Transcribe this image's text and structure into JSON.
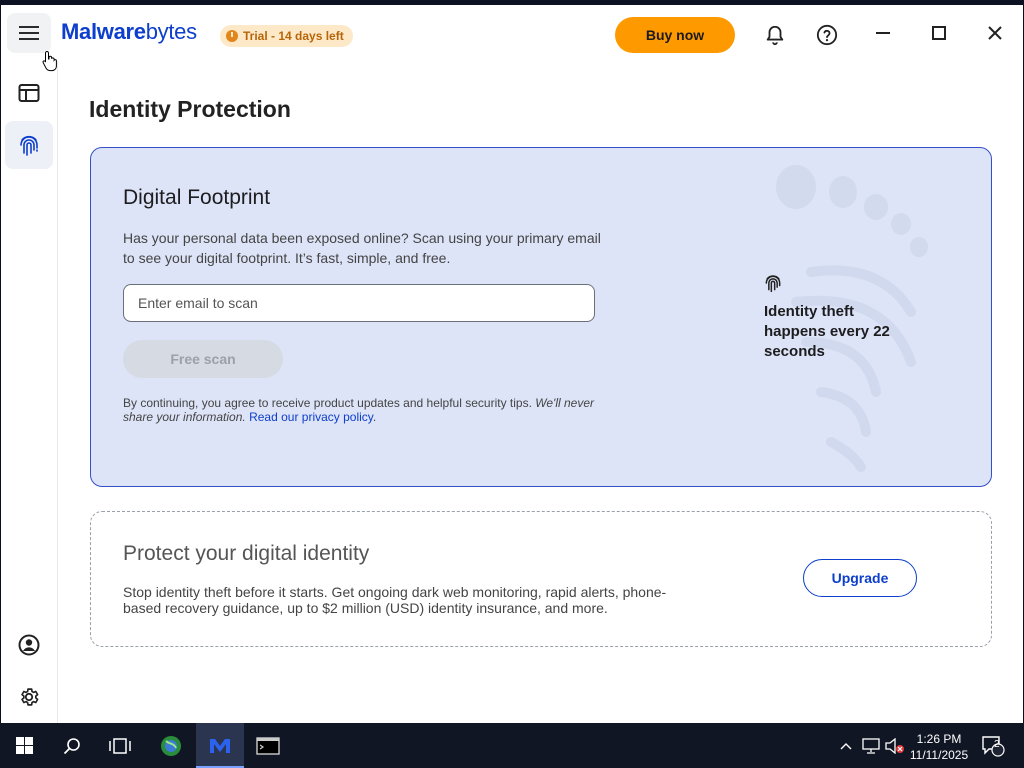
{
  "titlebar": {
    "logo_bold": "Malware",
    "logo_regular": "bytes",
    "trial_badge": "Trial - 14 days left",
    "buy_label": "Buy now"
  },
  "page": {
    "title": "Identity Protection"
  },
  "digital_footprint": {
    "heading": "Digital Footprint",
    "description": "Has your personal data been exposed online? Scan using your primary email to see your digital footprint. It’s fast, simple, and free.",
    "email_placeholder": "Enter email to scan",
    "scan_label": "Free scan",
    "consent_text": "By continuing, you agree to receive product updates and helpful security tips. ",
    "consent_italic": "We'll never share your information.",
    "privacy_link": "Read our privacy policy",
    "privacy_suffix": ".",
    "stat_text": "Identity theft happens every 22 seconds"
  },
  "protect": {
    "heading": "Protect your digital identity",
    "description": "Stop identity theft before it starts. Get ongoing dark web monitoring, rapid alerts, phone-based recovery guidance, up to $2 million (USD) identity insurance, and more.",
    "upgrade_label": "Upgrade"
  },
  "taskbar": {
    "time": "1:26 PM",
    "date": "11/11/2025",
    "notification_count": "2"
  },
  "colors": {
    "brand_blue": "#0d3ecc",
    "buy_orange": "#ff9900",
    "card_bg": "#dde4f7"
  },
  "icons": [
    "hamburger-icon",
    "dashboard-icon",
    "fingerprint-icon",
    "account-icon",
    "settings-icon",
    "bell-icon",
    "help-icon",
    "minimize-icon",
    "maximize-icon",
    "close-icon"
  ]
}
